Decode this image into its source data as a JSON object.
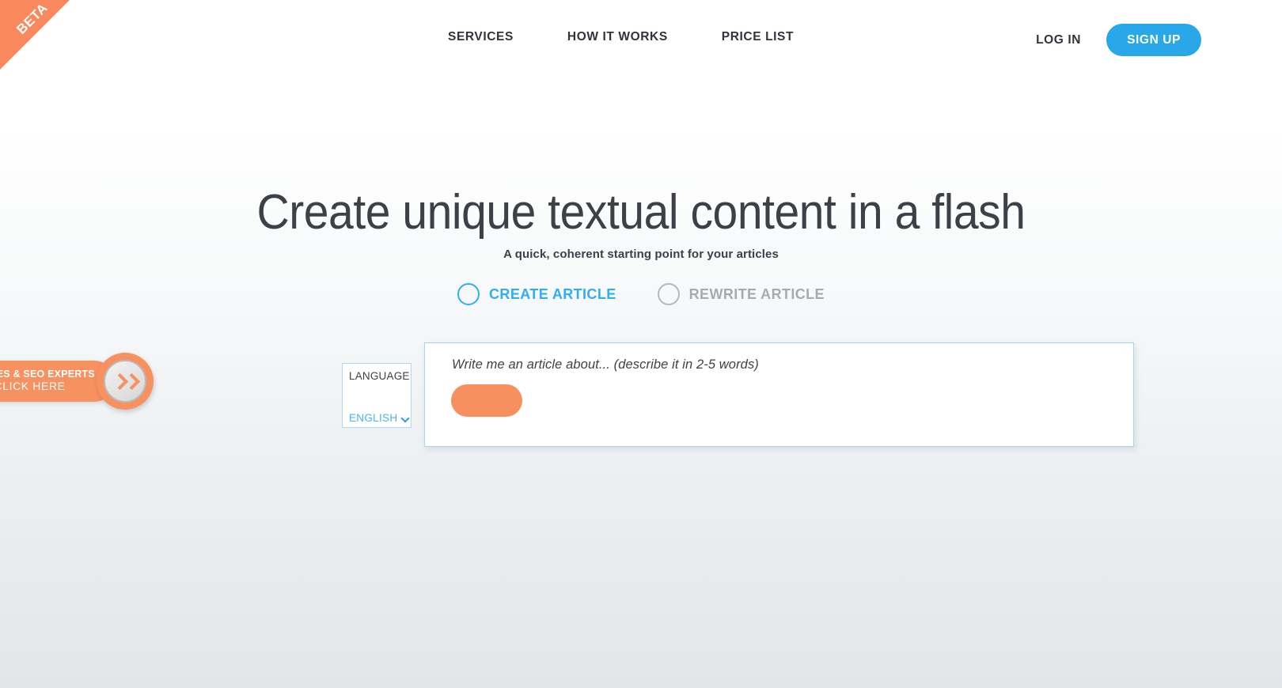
{
  "ribbon": {
    "label": "BETA"
  },
  "header": {
    "nav_items": [
      {
        "label": "SERVICES",
        "name": "nav-link-services"
      },
      {
        "label": "HOW IT WORKS",
        "name": "nav-link-how-it-works"
      },
      {
        "label": "PRICE LIST",
        "name": "nav-link-price-list"
      }
    ],
    "login_label": "LOG IN",
    "signup_label": "SIGN UP",
    "signup_color": "#28a8e9"
  },
  "hero": {
    "title": "Create unique textual content in a flash",
    "subtitle": "A quick, coherent starting point for your articles"
  },
  "modes": {
    "options": [
      {
        "label": "CREATE ARTICLE",
        "selected": true,
        "color": "#31aef0"
      },
      {
        "label": "REWRITE ARTICLE",
        "selected": false,
        "color": "#a7abb0"
      }
    ]
  },
  "form": {
    "language": {
      "label": "LANGUAGE",
      "value": "ENGLISH",
      "options": [
        "ENGLISH"
      ]
    },
    "article": {
      "placeholder": "Write me an article about... (describe it in 2-5 words)",
      "input_value": "",
      "submit_label": "",
      "submit_color": "#f7905e"
    },
    "panel_border_color": "#a8d6ed"
  },
  "promo": {
    "line1": "GENCIES & SEO EXPERTS",
    "line2": "CLICK HERE",
    "accent_color": "#f7915f"
  }
}
